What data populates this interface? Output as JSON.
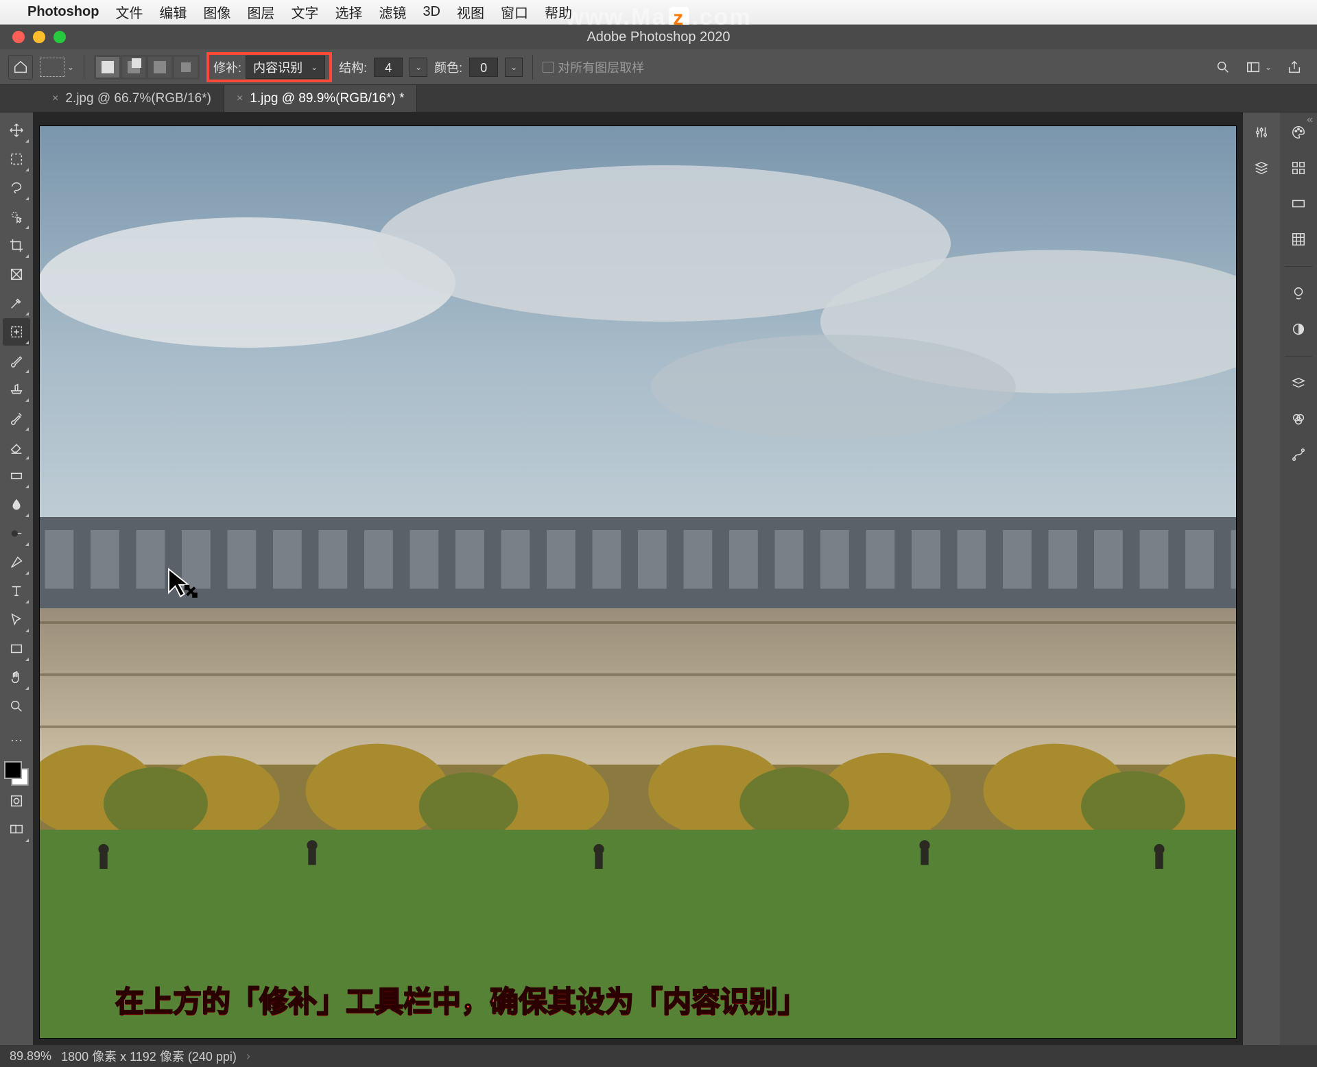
{
  "menubar": {
    "app": "Photoshop",
    "items": [
      "文件",
      "编辑",
      "图像",
      "图层",
      "文字",
      "选择",
      "滤镜",
      "3D",
      "视图",
      "窗口",
      "帮助"
    ]
  },
  "window": {
    "title": "Adobe Photoshop 2020"
  },
  "watermark": {
    "left": "www.Ma",
    "z": "z",
    "right": ".com"
  },
  "options": {
    "patch_label": "修补:",
    "patch_mode": "内容识别",
    "structure_label": "结构:",
    "structure_value": "4",
    "color_label": "颜色:",
    "color_value": "0",
    "sample_all_label": "对所有图层取样"
  },
  "tabs": [
    {
      "label": "2.jpg @ 66.7%(RGB/16*)",
      "active": false
    },
    {
      "label": "1.jpg @ 89.9%(RGB/16*) *",
      "active": true
    }
  ],
  "status": {
    "zoom": "89.89%",
    "dims": "1800 像素 x 1192 像素 (240 ppi)"
  },
  "caption": "在上方的「修补」工具栏中，确保其设为「内容识别」",
  "tools": [
    "move",
    "marquee",
    "lasso",
    "quick-select",
    "crop",
    "frame",
    "eyedropper",
    "patch",
    "brush",
    "clone",
    "history-brush",
    "eraser",
    "gradient",
    "blur",
    "dodge",
    "pen",
    "type",
    "path-select",
    "rectangle",
    "hand",
    "zoom"
  ],
  "right_panels_col1": [
    "properties",
    "3d",
    "divider"
  ],
  "right_panels_col2": [
    "color",
    "swatches",
    "gradient-panel",
    "patterns",
    "divider",
    "adjust-bulb",
    "adjust-circle",
    "divider",
    "layers",
    "channels",
    "paths"
  ]
}
